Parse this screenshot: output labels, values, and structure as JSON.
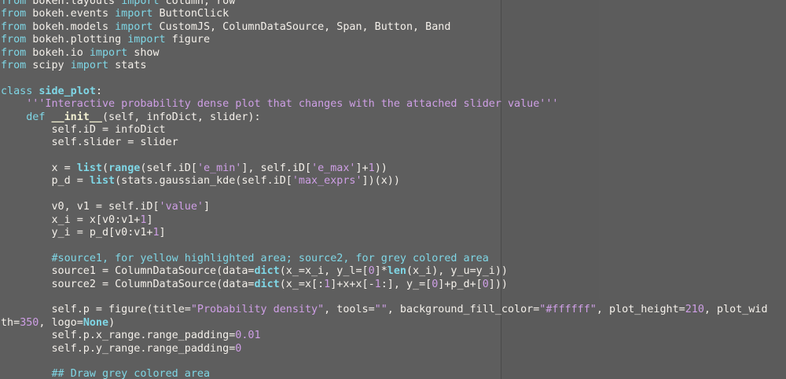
{
  "editor": {
    "lines": [
      [
        {
          "t": "from",
          "k": "kw"
        },
        {
          "t": " bokeh.layouts ",
          "k": ""
        },
        {
          "t": "import",
          "k": "kw"
        },
        {
          "t": " column, row",
          "k": ""
        }
      ],
      [
        {
          "t": "from",
          "k": "kw"
        },
        {
          "t": " bokeh.events ",
          "k": ""
        },
        {
          "t": "import",
          "k": "kw"
        },
        {
          "t": " ButtonClick",
          "k": ""
        }
      ],
      [
        {
          "t": "from",
          "k": "kw"
        },
        {
          "t": " bokeh.models ",
          "k": ""
        },
        {
          "t": "import",
          "k": "kw"
        },
        {
          "t": " CustomJS, ColumnDataSource, Span, Button, Band",
          "k": ""
        }
      ],
      [
        {
          "t": "from",
          "k": "kw"
        },
        {
          "t": " bokeh.plotting ",
          "k": ""
        },
        {
          "t": "import",
          "k": "kw"
        },
        {
          "t": " figure",
          "k": ""
        }
      ],
      [
        {
          "t": "from",
          "k": "kw"
        },
        {
          "t": " bokeh.io ",
          "k": ""
        },
        {
          "t": "import",
          "k": "kw"
        },
        {
          "t": " show",
          "k": ""
        }
      ],
      [
        {
          "t": "from",
          "k": "kw"
        },
        {
          "t": " scipy ",
          "k": ""
        },
        {
          "t": "import",
          "k": "kw"
        },
        {
          "t": " stats",
          "k": ""
        }
      ],
      [],
      [
        {
          "t": "class",
          "k": "kw"
        },
        {
          "t": " ",
          "k": ""
        },
        {
          "t": "side_plot",
          "k": "cls"
        },
        {
          "t": ":",
          "k": ""
        }
      ],
      [
        {
          "t": "    ",
          "k": ""
        },
        {
          "t": "'''Interactive probability dense plot that changes with the attached slider value'''",
          "k": "str"
        }
      ],
      [
        {
          "t": "    ",
          "k": ""
        },
        {
          "t": "def",
          "k": "kw"
        },
        {
          "t": " ",
          "k": ""
        },
        {
          "t": "__init__",
          "k": "def"
        },
        {
          "t": "(self, infoDict, slider):",
          "k": ""
        }
      ],
      [
        {
          "t": "        self.iD = infoDict",
          "k": ""
        }
      ],
      [
        {
          "t": "        self.slider = slider",
          "k": ""
        }
      ],
      [],
      [
        {
          "t": "        x = ",
          "k": ""
        },
        {
          "t": "list",
          "k": "fn"
        },
        {
          "t": "(",
          "k": ""
        },
        {
          "t": "range",
          "k": "fn"
        },
        {
          "t": "(self.iD[",
          "k": ""
        },
        {
          "t": "'e_min'",
          "k": "str"
        },
        {
          "t": "], self.iD[",
          "k": ""
        },
        {
          "t": "'e_max'",
          "k": "str"
        },
        {
          "t": "]+",
          "k": ""
        },
        {
          "t": "1",
          "k": "num"
        },
        {
          "t": "))",
          "k": ""
        }
      ],
      [
        {
          "t": "        p_d = ",
          "k": ""
        },
        {
          "t": "list",
          "k": "fn"
        },
        {
          "t": "(stats.gaussian_kde(self.iD[",
          "k": ""
        },
        {
          "t": "'max_exprs'",
          "k": "str"
        },
        {
          "t": "])(x))",
          "k": ""
        }
      ],
      [],
      [
        {
          "t": "        v0, v1 = self.iD[",
          "k": ""
        },
        {
          "t": "'value'",
          "k": "str"
        },
        {
          "t": "]",
          "k": ""
        }
      ],
      [
        {
          "t": "        x_i = x[v0:v1+",
          "k": ""
        },
        {
          "t": "1",
          "k": "num"
        },
        {
          "t": "]",
          "k": ""
        }
      ],
      [
        {
          "t": "        y_i = p_d[v0:v1+",
          "k": ""
        },
        {
          "t": "1",
          "k": "num"
        },
        {
          "t": "]",
          "k": ""
        }
      ],
      [],
      [
        {
          "t": "        #source1, for yellow highlighted area; source2, for grey colored area",
          "k": "cm"
        }
      ],
      [
        {
          "t": "        source1 = ColumnDataSource(data=",
          "k": ""
        },
        {
          "t": "dict",
          "k": "fn"
        },
        {
          "t": "(x_=x_i, y_l=[",
          "k": ""
        },
        {
          "t": "0",
          "k": "num"
        },
        {
          "t": "]*",
          "k": ""
        },
        {
          "t": "len",
          "k": "fn"
        },
        {
          "t": "(x_i), y_u=y_i))",
          "k": ""
        }
      ],
      [
        {
          "t": "        source2 = ColumnDataSource(data=",
          "k": ""
        },
        {
          "t": "dict",
          "k": "fn"
        },
        {
          "t": "(x_=x[:",
          "k": ""
        },
        {
          "t": "1",
          "k": "num"
        },
        {
          "t": "]+x+x[-",
          "k": ""
        },
        {
          "t": "1",
          "k": "num"
        },
        {
          "t": ":], y_=[",
          "k": ""
        },
        {
          "t": "0",
          "k": "num"
        },
        {
          "t": "]+p_d+[",
          "k": ""
        },
        {
          "t": "0",
          "k": "num"
        },
        {
          "t": "]))",
          "k": ""
        }
      ],
      [],
      [
        {
          "t": "        self.p = figure(title=",
          "k": ""
        },
        {
          "t": "\"Probability density\"",
          "k": "str"
        },
        {
          "t": ", tools=",
          "k": ""
        },
        {
          "t": "\"\"",
          "k": "str"
        },
        {
          "t": ", background_fill_color=",
          "k": ""
        },
        {
          "t": "\"#ffffff\"",
          "k": "str"
        },
        {
          "t": ", plot_height=",
          "k": ""
        },
        {
          "t": "210",
          "k": "num"
        },
        {
          "t": ", plot_wid",
          "k": ""
        }
      ],
      [
        {
          "t": "th=",
          "k": ""
        },
        {
          "t": "350",
          "k": "num"
        },
        {
          "t": ", logo=",
          "k": ""
        },
        {
          "t": "None",
          "k": "fn"
        },
        {
          "t": ")",
          "k": ""
        }
      ],
      [
        {
          "t": "        self.p.x_range.range_padding=",
          "k": ""
        },
        {
          "t": "0.01",
          "k": "num"
        }
      ],
      [
        {
          "t": "        self.p.y_range.range_padding=",
          "k": ""
        },
        {
          "t": "0",
          "k": "num"
        }
      ],
      [],
      [
        {
          "t": "        ## Draw grey colored area",
          "k": "cm"
        }
      ]
    ]
  }
}
